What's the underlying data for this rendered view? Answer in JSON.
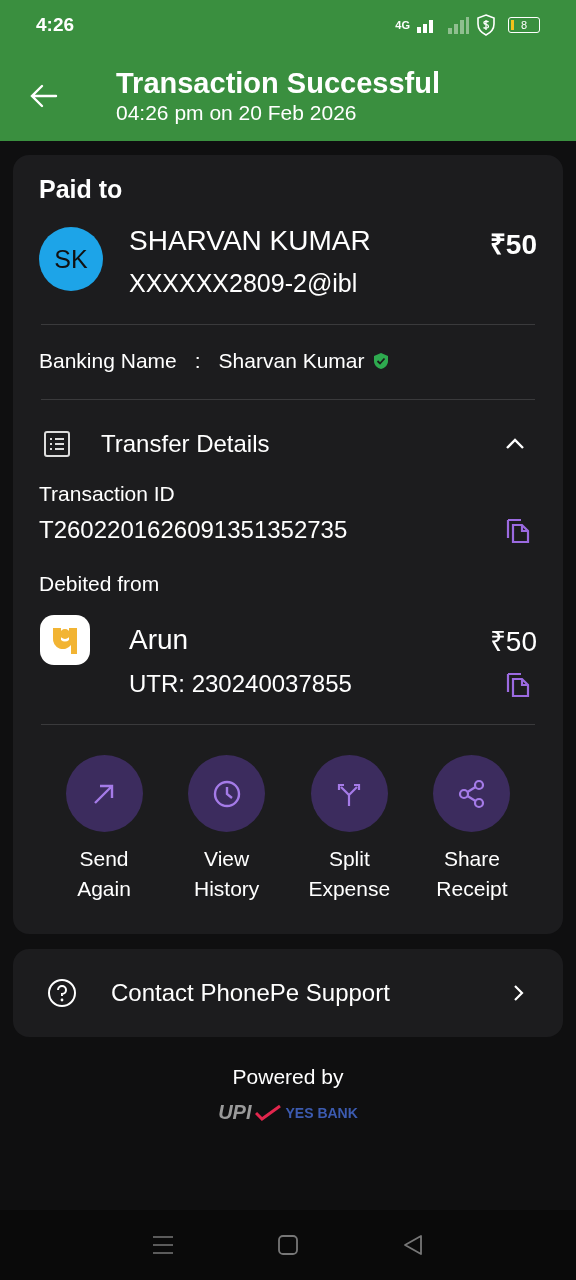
{
  "status_bar": {
    "time": "4:26",
    "network": "4G",
    "battery": "8"
  },
  "header": {
    "title": "Transaction Successful",
    "subtitle": "04:26 pm on 20 Feb 2026"
  },
  "paid_to": {
    "heading": "Paid to",
    "initials": "SK",
    "name": "SHARVAN KUMAR",
    "upi_id": "XXXXXX2809-2@ibl",
    "amount": "₹50",
    "banking_name_label": "Banking Name",
    "separator": ":",
    "banking_name": "Sharvan Kumar",
    "verified": true
  },
  "transfer_details": {
    "title": "Transfer Details",
    "expanded": true,
    "transaction_id_label": "Transaction ID",
    "transaction_id": "T2602201626091351352735",
    "debited_label": "Debited from",
    "account_name": "Arun",
    "account_amount": "₹50",
    "utr": "UTR: 230240037855"
  },
  "actions": [
    {
      "kind": "send",
      "label": "Send Again"
    },
    {
      "kind": "history",
      "label": "View History"
    },
    {
      "kind": "split",
      "label": "Split Expense"
    },
    {
      "kind": "share",
      "label": "Share Receipt"
    }
  ],
  "support": {
    "label": "Contact PhonePe Support"
  },
  "footer": {
    "powered_by": "Powered by",
    "logos": [
      "UPI",
      "YES BANK"
    ]
  }
}
